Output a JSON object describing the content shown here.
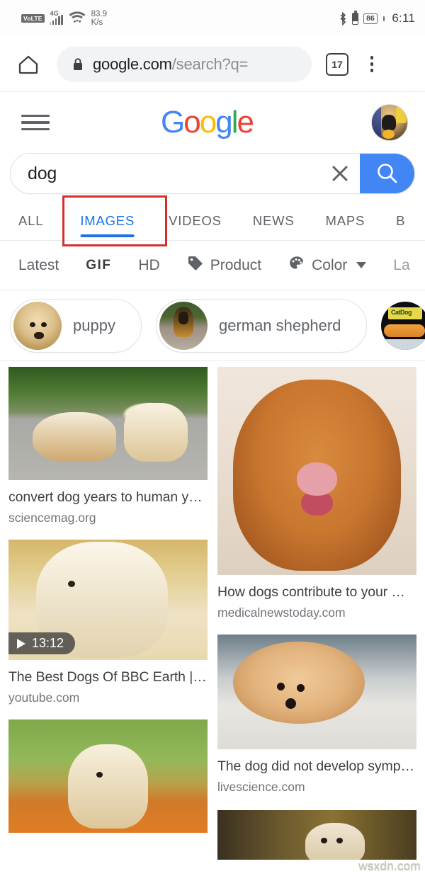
{
  "status_bar": {
    "volte_label": "VoLTE",
    "network_type": "4G",
    "net_speed_value": "83.9",
    "net_speed_unit": "K/s",
    "bluetooth_icon": "bluetooth-icon",
    "battery_percent": "86",
    "clock": "6:11"
  },
  "browser": {
    "home_icon": "home-icon",
    "lock_icon": "lock-icon",
    "url_domain": "google.com",
    "url_path": "/search?q=",
    "tab_count": "17",
    "menu_icon": "kebab-menu-icon"
  },
  "header": {
    "menu_icon": "hamburger-icon",
    "logo": {
      "l1": "G",
      "l2": "o",
      "l3": "o",
      "l4": "g",
      "l5": "l",
      "l6": "e",
      "colors": [
        "#4285F4",
        "#EA4335",
        "#FBBC05",
        "#4285F4",
        "#34A853",
        "#EA4335"
      ]
    },
    "avatar": "user-avatar"
  },
  "search": {
    "query": "dog",
    "placeholder": "Search",
    "clear_icon": "clear-x-icon",
    "search_icon": "search-icon",
    "search_button_color": "#4285F4"
  },
  "tabs": {
    "items": [
      {
        "label": "ALL",
        "active": false
      },
      {
        "label": "IMAGES",
        "active": true
      },
      {
        "label": "VIDEOS",
        "active": false
      },
      {
        "label": "NEWS",
        "active": false
      },
      {
        "label": "MAPS",
        "active": false
      },
      {
        "label": "B",
        "active": false
      }
    ],
    "active_color": "#1a73e8",
    "highlight_box_color": "#d32f2f"
  },
  "filters": {
    "items": [
      {
        "label": "Latest",
        "icon": "",
        "dropdown": false,
        "faded": false
      },
      {
        "label": "GIF",
        "icon": "",
        "dropdown": false,
        "faded": false
      },
      {
        "label": "HD",
        "icon": "",
        "dropdown": false,
        "faded": false
      },
      {
        "label": "Product",
        "icon": "tag-icon",
        "dropdown": false,
        "faded": false
      },
      {
        "label": "Color",
        "icon": "palette-icon",
        "dropdown": true,
        "faded": false
      },
      {
        "label": "La",
        "icon": "",
        "dropdown": false,
        "faded": true
      }
    ]
  },
  "related_chips": [
    {
      "label": "puppy",
      "image": "puppy-thumbnail"
    },
    {
      "label": "german shepherd",
      "image": "german-shepherd-thumbnail"
    },
    {
      "label": "",
      "image": "catdog-thumbnail"
    }
  ],
  "results": {
    "left_column": [
      {
        "title": "convert dog years to human y…",
        "source": "sciencemag.org",
        "image": "labrador-and-puppy-photo",
        "video": false
      },
      {
        "title": "The Best Dogs Of BBC Earth | …",
        "source": "youtube.com",
        "image": "yellow-lab-puppy-photo",
        "video": true,
        "duration": "13:12"
      },
      {
        "title": "",
        "source": "",
        "image": "golden-retriever-in-flowers-photo",
        "video": false
      }
    ],
    "right_column": [
      {
        "title": "How dogs contribute to your …",
        "source": "medicalnewstoday.com",
        "image": "toller-smiling-photo",
        "video": false
      },
      {
        "title": "The dog did not develop symp…",
        "source": "livescience.com",
        "image": "pomeranian-lying-down-photo",
        "video": false
      },
      {
        "title": "",
        "source": "",
        "image": "puppy-cropped-photo",
        "video": false
      }
    ]
  },
  "watermark": "wsxdn.com"
}
